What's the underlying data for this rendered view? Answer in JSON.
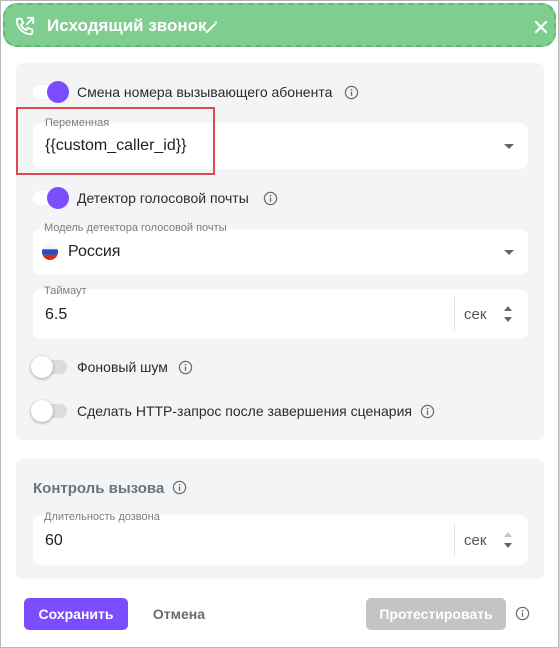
{
  "header": {
    "title": "Исходящий звонок"
  },
  "settings": {
    "caller_change": {
      "label": "Смена номера вызывающего абонента",
      "enabled": true
    },
    "variable": {
      "label": "Переменная",
      "value": "{{custom_caller_id}}"
    },
    "voicemail_detector": {
      "label": "Детектор голосовой почты",
      "enabled": true
    },
    "detector_model": {
      "label": "Модель детектора голосовой почты",
      "value": "Россия"
    },
    "timeout": {
      "label": "Таймаут",
      "value": "6.5",
      "unit": "сек"
    },
    "background_noise": {
      "label": "Фоновый шум",
      "enabled": false
    },
    "http_request": {
      "label": "Сделать HTTP-запрос после завершения сценария",
      "enabled": false
    }
  },
  "call_control": {
    "title": "Контроль вызова",
    "ring_duration": {
      "label": "Длительность дозвона",
      "value": "60",
      "unit": "сек"
    }
  },
  "footer": {
    "save_label": "Сохранить",
    "cancel_label": "Отмена",
    "test_label": "Протестировать"
  },
  "colors": {
    "accent": "#7b4dff",
    "header": "#7fce8f",
    "highlight": "#e0494f"
  }
}
